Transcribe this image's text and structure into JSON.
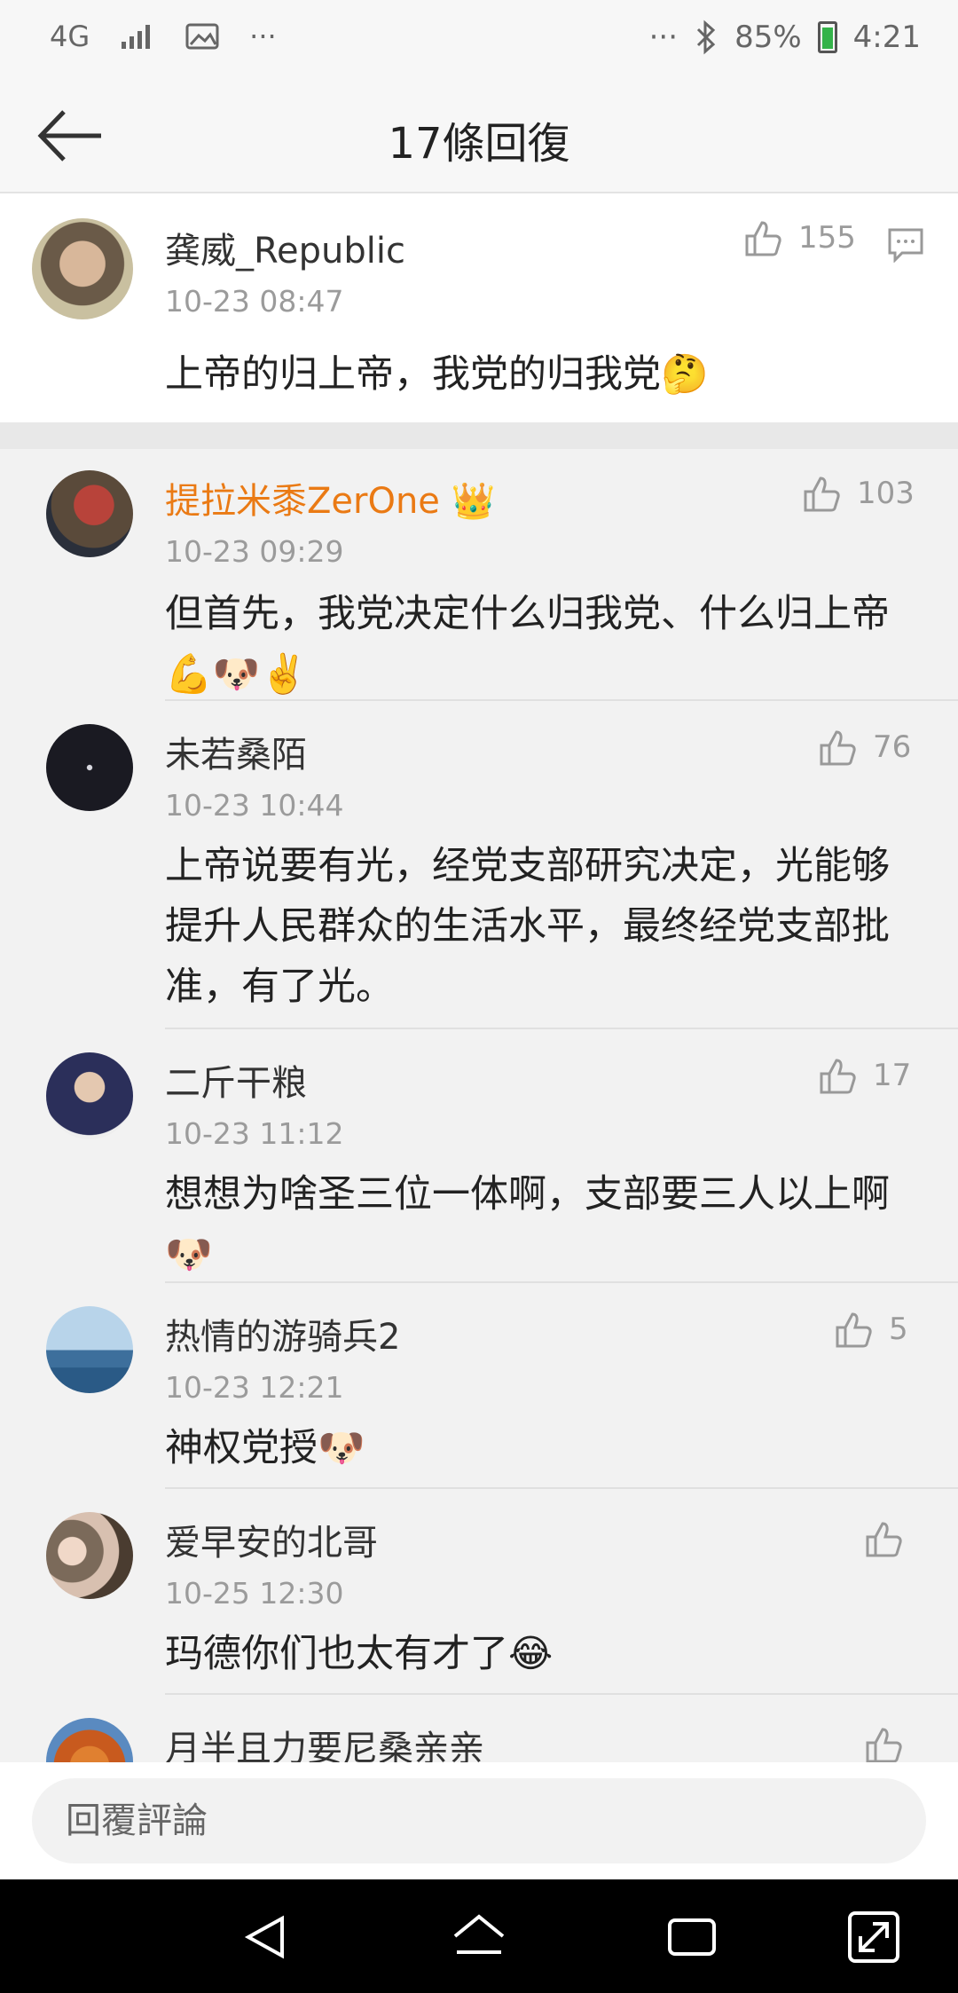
{
  "status_bar": {
    "network": "4G",
    "more": "···",
    "more_right": "···",
    "battery": "85%",
    "time": "4:21"
  },
  "header": {
    "title": "17條回復",
    "back_icon": "back-arrow-icon"
  },
  "main_comment": {
    "user": "龚威_Republic",
    "time": "10-23 08:47",
    "text": "上帝的归上帝，我党的归我党🤔",
    "likes": "155",
    "comment_icon": "comment-icon"
  },
  "replies": [
    {
      "user": "提拉米黍ZerOne 👑",
      "time": "10-23 09:29",
      "text": "但首先，我党决定什么归我党、什么归上帝💪🐶✌️",
      "likes": "103",
      "vip": true
    },
    {
      "user": "未若桑陌",
      "time": "10-23 10:44",
      "text": "上帝说要有光，经党支部研究决定，光能够提升人民群众的生活水平，最终经党支部批准，有了光。",
      "likes": "76"
    },
    {
      "user": "二斤干粮",
      "time": "10-23 11:12",
      "text": "想想为啥圣三位一体啊，支部要三人以上啊🐶",
      "likes": "17"
    },
    {
      "user": "热情的游骑兵2",
      "time": "10-23 12:21",
      "text": "神权党授🐶",
      "likes": "5"
    },
    {
      "user": "爱早安的北哥",
      "time": "10-25 12:30",
      "text": "玛德你们也太有才了😂",
      "likes": ""
    },
    {
      "user": "月半且力要尼桑亲亲",
      "time": "",
      "text": "",
      "likes": ""
    }
  ],
  "input": {
    "placeholder": "回覆評論"
  },
  "colors": {
    "vip_name": "#ea7a14",
    "battery": "#34b34a"
  }
}
